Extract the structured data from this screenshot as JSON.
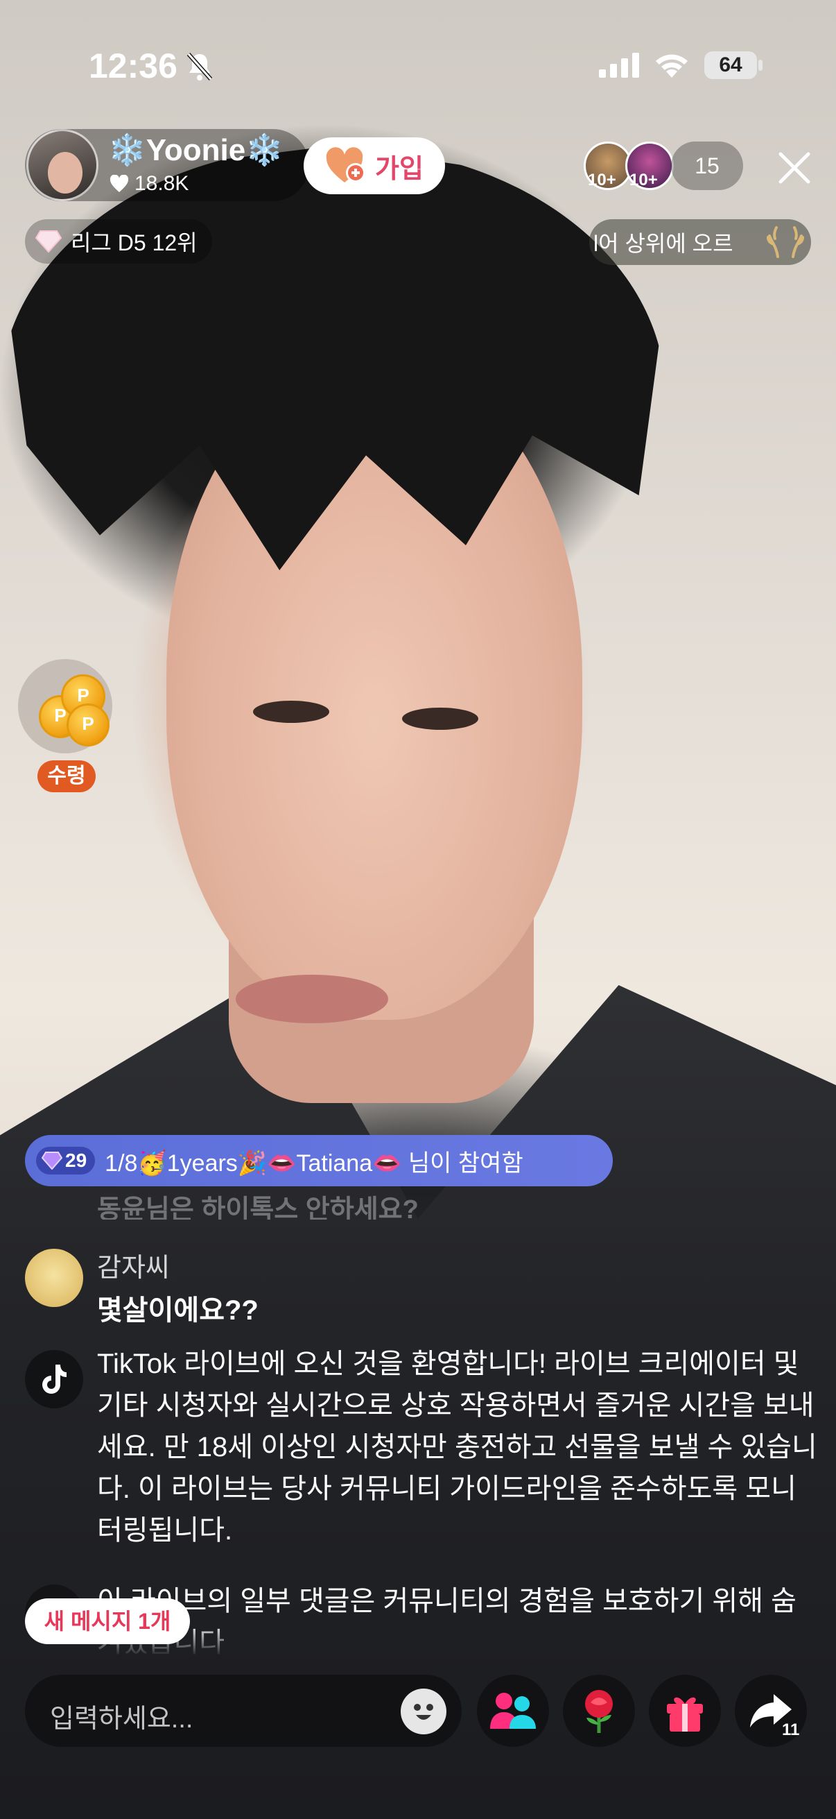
{
  "status_bar": {
    "time": "12:36",
    "battery": "64"
  },
  "host": {
    "name": "❄️Yoonie❄️",
    "likes": "18.8K",
    "join_label": "가입"
  },
  "viewers": {
    "badge_1": "10+",
    "badge_2": "10+",
    "count": "15"
  },
  "league": {
    "label": "리그 D5 12위"
  },
  "rank_ticker": {
    "text": "l어 상위에 오르"
  },
  "reward": {
    "label": "수령"
  },
  "joined_banner": {
    "gem_count": "29",
    "text": "1/8🥳1years🎉👄Tatiana👄 님이 참여함"
  },
  "ghost_comment": {
    "text": "동윤님은 하이톡스 안하세요?"
  },
  "comment": {
    "user": "감자씨",
    "text": "몇살이에요??"
  },
  "system_message": {
    "welcome": "TikTok 라이브에 오신 것을 환영합니다! 라이브 크리에이터 및 기타 시청자와 실시간으로 상호 작용하면서 즐거운 시간을 보내세요. 만 18세 이상인 시청자만 충전하고 선물을 보낼 수 있습니다. 이 라이브는 당사 커뮤니티 가이드라인을 준수하도록 모니터링됩니다.",
    "notice": "이 라이브의 일부 댓글은 커뮤니티의 경험을 보호하기 위해 숨겨졌습니다"
  },
  "new_message_pill": {
    "label": "새 메시지 1개"
  },
  "input": {
    "placeholder": "입력하세요..."
  },
  "actions": {
    "share_count": "11"
  },
  "colors": {
    "join_text": "#e2476b",
    "banner": "#5b6ed8",
    "new_msg_text": "#e8385a",
    "reward_badge": "#e15a22"
  }
}
